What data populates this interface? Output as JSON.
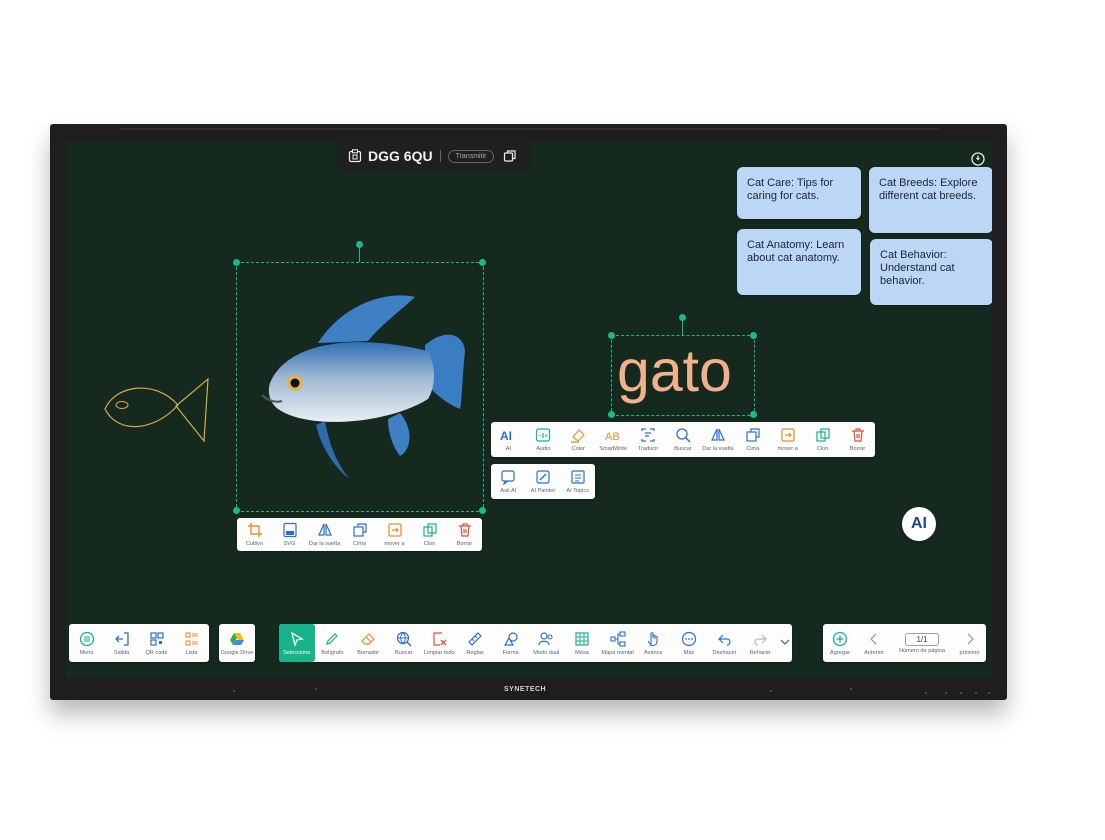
{
  "device": {
    "brand": "SYNETECH"
  },
  "titlebar": {
    "room_code": "DGG 6QU",
    "transmit_label": "Transmitir"
  },
  "sticky_notes": [
    {
      "text": "Cat Care: Tips for caring for cats."
    },
    {
      "text": "Cat Breeds: Explore different cat breeds."
    },
    {
      "text": "Cat Anatomy: Learn about cat anatomy."
    },
    {
      "text": "Cat Behavior: Understand cat behavior."
    }
  ],
  "canvas": {
    "word": "gato"
  },
  "ai_fab": {
    "label": "AI"
  },
  "image_toolbar": [
    {
      "label": "Cultivo",
      "icon": "crop-icon"
    },
    {
      "label": "SVG",
      "icon": "svg-icon"
    },
    {
      "label": "Dar la vuelta",
      "icon": "flip-icon"
    },
    {
      "label": "Cima",
      "icon": "bring-to-top-icon"
    },
    {
      "label": "mover a",
      "icon": "move-to-icon"
    },
    {
      "label": "Clon",
      "icon": "clone-icon"
    },
    {
      "label": "Borrar",
      "icon": "trash-icon"
    }
  ],
  "text_toolbar": [
    {
      "label": "AI",
      "icon": "ai-icon"
    },
    {
      "label": "Audio",
      "icon": "audio-icon"
    },
    {
      "label": "Color",
      "icon": "color-icon"
    },
    {
      "label": "SmartWrite",
      "icon": "smartwrite-icon"
    },
    {
      "label": "Traducir",
      "icon": "translate-icon"
    },
    {
      "label": "Buscar",
      "icon": "search-icon"
    },
    {
      "label": "Dar la vuelta",
      "icon": "flip-icon"
    },
    {
      "label": "Cima",
      "icon": "bring-to-top-icon"
    },
    {
      "label": "mover a",
      "icon": "move-to-icon"
    },
    {
      "label": "Clon",
      "icon": "clone-icon"
    },
    {
      "label": "Borrar",
      "icon": "trash-icon"
    }
  ],
  "ai_submenu": [
    {
      "label": "Ask AI",
      "icon": "ask-ai-icon"
    },
    {
      "label": "AI Painter",
      "icon": "ai-painter-icon"
    },
    {
      "label": "AI Topics",
      "icon": "ai-topics-icon"
    }
  ],
  "bottom_left_toolbar": [
    {
      "label": "Menú",
      "icon": "menu-icon"
    },
    {
      "label": "Salida",
      "icon": "exit-icon"
    },
    {
      "label": "QR code",
      "icon": "qr-code-icon"
    },
    {
      "label": "Lista",
      "icon": "list-icon"
    }
  ],
  "drive": {
    "label": "Google Drive",
    "icon": "google-drive-icon"
  },
  "main_toolbar": [
    {
      "label": "Seleccione",
      "icon": "cursor-icon"
    },
    {
      "label": "Bolígrafo",
      "icon": "pen-icon"
    },
    {
      "label": "Borrador",
      "icon": "eraser-icon"
    },
    {
      "label": "Buscar",
      "icon": "globe-search-icon"
    },
    {
      "label": "Limpiar todo",
      "icon": "clear-all-icon"
    },
    {
      "label": "Reglas",
      "icon": "ruler-icon"
    },
    {
      "label": "Forma",
      "icon": "shape-icon"
    },
    {
      "label": "Modo dual",
      "icon": "dual-mode-icon"
    },
    {
      "label": "Mesa",
      "icon": "table-icon"
    },
    {
      "label": "Mapa mental",
      "icon": "mind-map-icon"
    },
    {
      "label": "Avance",
      "icon": "hand-icon"
    },
    {
      "label": "Más",
      "icon": "more-icon"
    },
    {
      "label": "Deshacer",
      "icon": "undo-icon"
    },
    {
      "label": "Rehacer",
      "icon": "redo-icon"
    }
  ],
  "page_nav": {
    "add_label": "Agregar",
    "prev_label": "Anterior",
    "page_indicator": "1/1",
    "page_number_label": "Número de página",
    "next_label": "próximo"
  },
  "colors": {
    "board": "#15291f",
    "accent": "#17b38b",
    "note": "#bcd6f6",
    "word": "#f1b28b",
    "sketch": "#d8a94a"
  }
}
